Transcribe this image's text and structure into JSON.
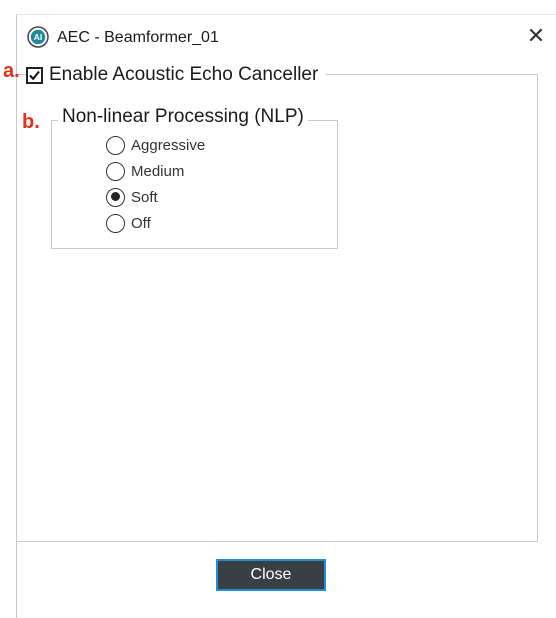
{
  "window": {
    "title": "AEC - Beamformer_01",
    "app_icon": "ai-logo-icon",
    "close_glyph": "✕"
  },
  "annotations": {
    "a": "a.",
    "b": "b."
  },
  "aec": {
    "enable_label": "Enable Acoustic Echo Canceller",
    "enabled": true
  },
  "nlp": {
    "title": "Non-linear Processing (NLP)",
    "options": [
      {
        "label": "Aggressive",
        "selected": false
      },
      {
        "label": "Medium",
        "selected": false
      },
      {
        "label": "Soft",
        "selected": true
      },
      {
        "label": "Off",
        "selected": false
      }
    ]
  },
  "footer": {
    "close_label": "Close"
  },
  "colors": {
    "annotation": "#e8301c",
    "button_bg": "#3a3f44",
    "button_border": "#1c8fd6",
    "icon_teal": "#1f8a9a"
  }
}
